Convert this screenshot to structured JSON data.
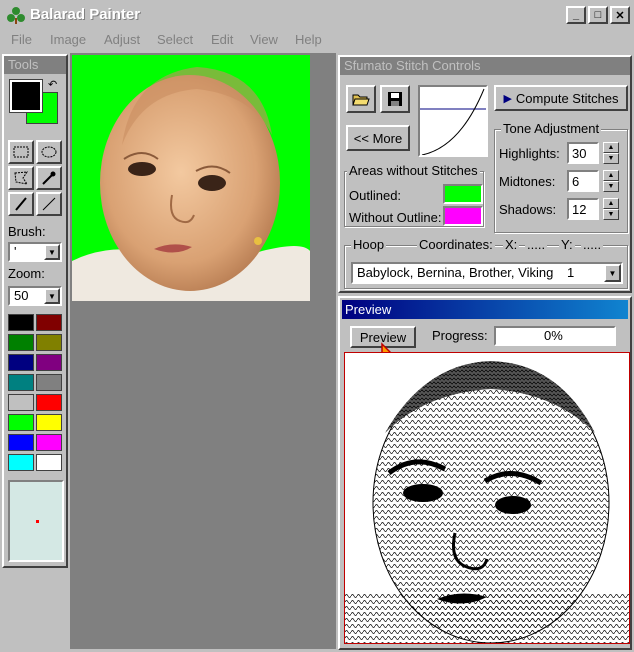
{
  "window": {
    "title": "Balarad Painter"
  },
  "menu": [
    "File",
    "Image",
    "Adjust",
    "Select",
    "Edit",
    "View",
    "Help"
  ],
  "tools": {
    "title": "Tools",
    "brush_label": "Brush:",
    "brush_value": "'",
    "zoom_label": "Zoom:",
    "zoom_value": "50",
    "palette": [
      "#000000",
      "#800000",
      "#008000",
      "#808000",
      "#000080",
      "#800080",
      "#008080",
      "#808080",
      "#c0c0c0",
      "#ff0000",
      "#00ff00",
      "#ffff00",
      "#0000ff",
      "#ff00ff",
      "#00ffff",
      "#ffffff"
    ]
  },
  "stitch": {
    "title": "Sfumato Stitch Controls",
    "compute_label": "Compute Stitches",
    "more_label": "<< More",
    "areas_label": "Areas without Stitches",
    "outlined_label": "Outlined:",
    "outlined_color": "#00ff00",
    "without_outline_label": "Without Outline:",
    "without_outline_color": "#ff00ff",
    "tone_label": "Tone Adjustment",
    "highlights_label": "Highlights:",
    "highlights_value": "30",
    "midtones_label": "Midtones:",
    "midtones_value": "6",
    "shadows_label": "Shadows:",
    "shadows_value": "12",
    "hoop_label": "Hoop",
    "coordinates_label": "Coordinates:",
    "x_label": "X:",
    "x_value": ".....",
    "y_label": "Y:",
    "y_value": ".....",
    "hoop_value": "Babylock, Bernina, Brother, Viking",
    "hoop_size": "1"
  },
  "preview": {
    "title": "Preview",
    "button_label": "Preview",
    "progress_label": "Progress:",
    "progress_value": "0%"
  }
}
